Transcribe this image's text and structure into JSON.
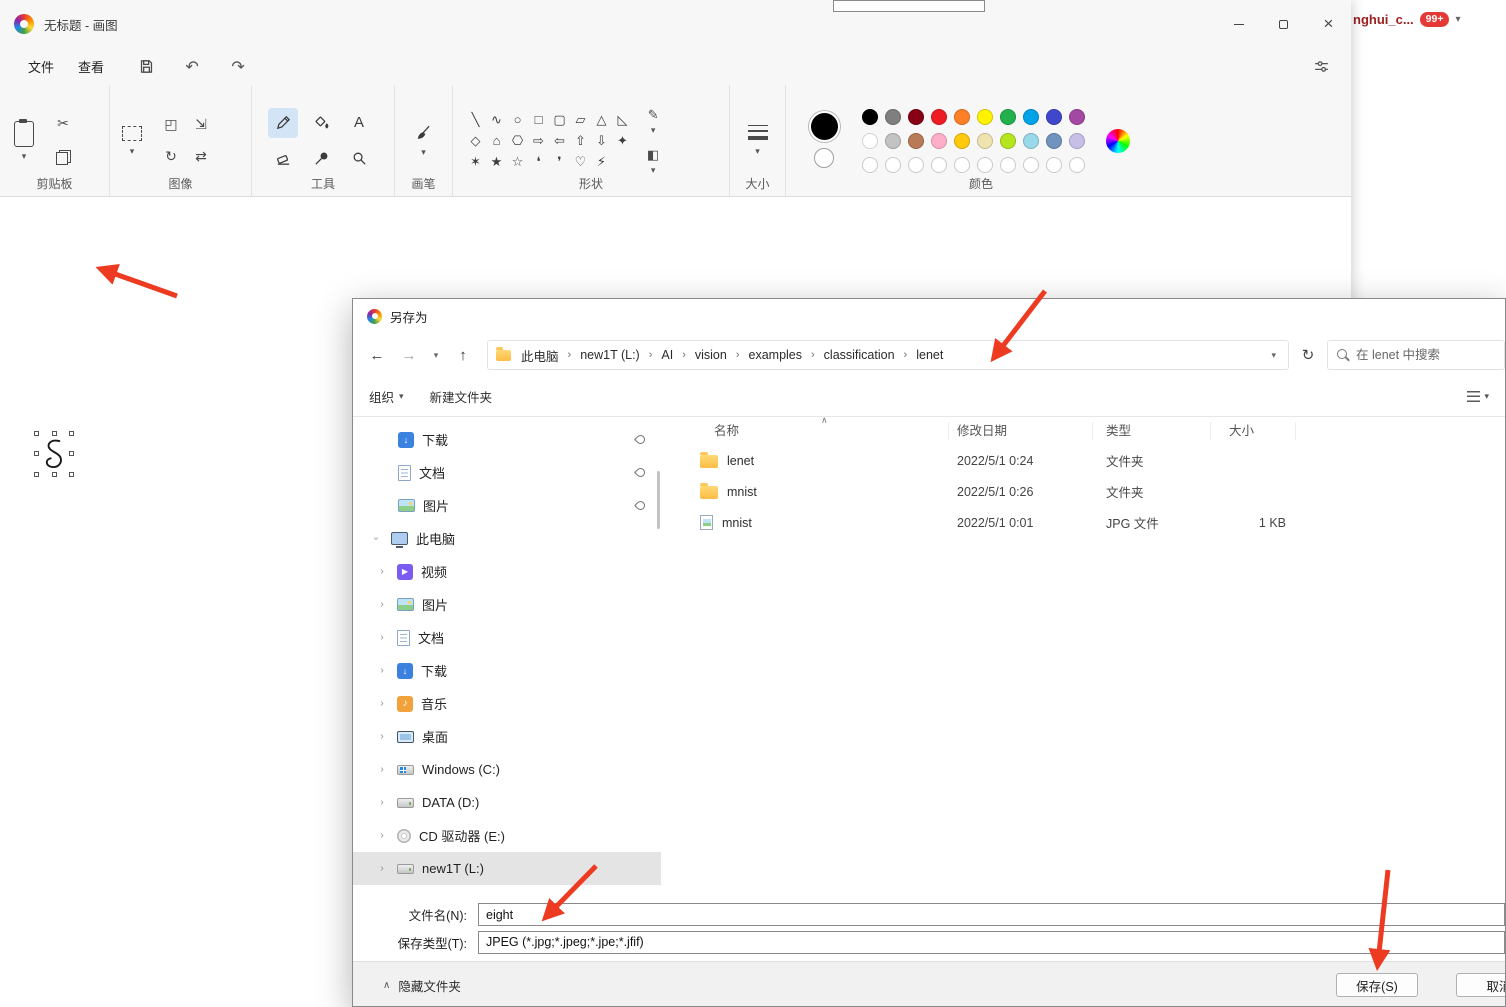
{
  "background": {
    "account_text": "nghui_c...",
    "badge": "99+"
  },
  "paint": {
    "title": "无标题 - 画图",
    "menu": [
      "文件",
      "查看"
    ],
    "groups": {
      "clipboard": "剪贴板",
      "image": "图像",
      "tools": "工具",
      "brushes": "画笔",
      "shapes": "形状",
      "size": "大小",
      "colors": "颜色"
    },
    "shape_rows": [
      [
        "╲",
        "∿",
        "○",
        "□",
        "▢",
        "▱",
        "△",
        "◺"
      ],
      [
        "◇",
        "⌂",
        "⎔",
        "⇨",
        "⇦",
        "⇧",
        "⇩",
        "✦"
      ],
      [
        "✶",
        "★",
        "☆",
        "❛",
        "❜",
        "♡",
        "⚡"
      ]
    ],
    "palette_row1": [
      "#000000",
      "#7f7f7f",
      "#880015",
      "#ed1c24",
      "#ff7f27",
      "#fff200",
      "#22b14c",
      "#00a2e8",
      "#3f48cc",
      "#a349a4"
    ],
    "palette_row2": [
      "#ffffff",
      "#c3c3c3",
      "#b97a57",
      "#ffaec9",
      "#ffc90e",
      "#efe4b0",
      "#b5e61d",
      "#99d9ea",
      "#7092be",
      "#c8bfe7"
    ],
    "empty_slots": 10,
    "color1": "#000000",
    "color2": "#ffffff"
  },
  "dialog": {
    "title": "另存为",
    "breadcrumb": [
      "此电脑",
      "new1T (L:)",
      "AI",
      "vision",
      "examples",
      "classification",
      "lenet"
    ],
    "search_placeholder": "在 lenet 中搜索",
    "organize": "组织",
    "new_folder": "新建文件夹",
    "quick_access": [
      {
        "label": "下载",
        "icon": "download"
      },
      {
        "label": "文档",
        "icon": "doc"
      },
      {
        "label": "图片",
        "icon": "pic"
      }
    ],
    "this_pc": "此电脑",
    "tree": [
      {
        "label": "视频",
        "icon": "video"
      },
      {
        "label": "图片",
        "icon": "pic"
      },
      {
        "label": "文档",
        "icon": "doc"
      },
      {
        "label": "下载",
        "icon": "download"
      },
      {
        "label": "音乐",
        "icon": "music"
      },
      {
        "label": "桌面",
        "icon": "desktop"
      },
      {
        "label": "Windows (C:)",
        "icon": "win"
      },
      {
        "label": "DATA (D:)",
        "icon": "drive"
      },
      {
        "label": "CD 驱动器 (E:)",
        "icon": "cd"
      },
      {
        "label": "new1T (L:)",
        "icon": "drive",
        "selected": true
      }
    ],
    "list_headers": [
      "名称",
      "修改日期",
      "类型",
      "大小"
    ],
    "files": [
      {
        "name": "lenet",
        "date": "2022/5/1 0:24",
        "type": "文件夹",
        "size": "",
        "icon": "folder"
      },
      {
        "name": "mnist",
        "date": "2022/5/1 0:26",
        "type": "文件夹",
        "size": "",
        "icon": "folder"
      },
      {
        "name": "mnist",
        "date": "2022/5/1 0:01",
        "type": "JPG 文件",
        "size": "1 KB",
        "icon": "imgfile"
      }
    ],
    "filename_label": "文件名(N):",
    "filename_value": "eight",
    "filetype_label": "保存类型(T):",
    "filetype_value": "JPEG (*.jpg;*.jpeg;*.jpe;*.jfif)",
    "hide_folders": "隐藏文件夹",
    "save": "保存(S)",
    "cancel": "取消"
  },
  "colors": {
    "annotation_arrow": "#ed3b22",
    "selection_highlight": "#e4e4e4"
  }
}
